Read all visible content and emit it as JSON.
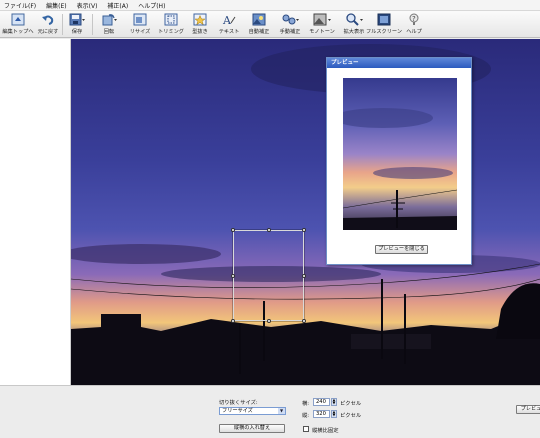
{
  "menu": [
    "ファイル(F)",
    "編集(E)",
    "表示(V)",
    "補正(A)",
    "ヘルプ(H)"
  ],
  "toolbar": {
    "items": [
      {
        "label": "編集トップへ",
        "icon": "edit-top-icon"
      },
      {
        "label": "元に戻す",
        "icon": "undo-icon"
      },
      {
        "label": "保存",
        "icon": "save-icon"
      },
      {
        "label": "回転",
        "icon": "rotate-icon"
      },
      {
        "label": "リサイズ",
        "icon": "resize-icon"
      },
      {
        "label": "トリミング",
        "icon": "trim-icon"
      },
      {
        "label": "型抜き",
        "icon": "shape-cut-icon"
      },
      {
        "label": "テキスト",
        "icon": "text-icon"
      },
      {
        "label": "自動補正",
        "icon": "auto-correct-icon"
      },
      {
        "label": "手動補正",
        "icon": "manual-correct-icon"
      },
      {
        "label": "モノトーン",
        "icon": "monotone-icon"
      },
      {
        "label": "拡大表示",
        "icon": "zoom-icon"
      },
      {
        "label": "フルスクリーン",
        "icon": "fullscreen-icon"
      },
      {
        "label": "ヘルプ",
        "icon": "help-icon"
      }
    ]
  },
  "preview": {
    "title": "プレビュー",
    "close_label": "プレビューを閉じる"
  },
  "bottom": {
    "size_label": "切り抜くサイズ:",
    "size_value": "フリーサイズ",
    "swap_label": "縦横の入れ替え",
    "width_label": "横:",
    "width_value": "240",
    "width_unit": "ピクセル",
    "height_label": "縦:",
    "height_value": "320",
    "height_unit": "ピクセル",
    "ratio_label": "縦横比固定",
    "right_button": "プレビュ"
  }
}
